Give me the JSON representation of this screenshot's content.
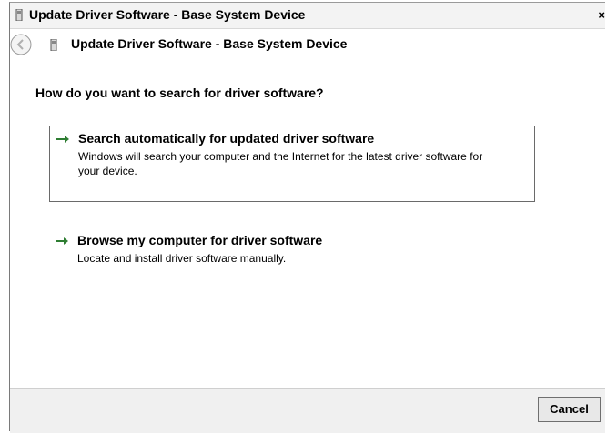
{
  "window": {
    "title": "Update Driver Software - Base System Device",
    "close_label": "×"
  },
  "nav": {
    "title": "Update Driver Software - Base System Device"
  },
  "main": {
    "question": "How do you want to search for driver software?",
    "options": [
      {
        "title": "Search automatically for updated driver software",
        "description": "Windows will search your computer and the Internet for the latest driver software for your device."
      },
      {
        "title": "Browse my computer for driver software",
        "description": "Locate and install driver software manually."
      }
    ]
  },
  "footer": {
    "cancel_label": "Cancel"
  },
  "icons": {
    "title": "device-icon",
    "back": "back-arrow-icon",
    "option": "green-arrow-icon"
  },
  "colors": {
    "arrow": "#2e7d32",
    "border": "#6a6a6a"
  }
}
